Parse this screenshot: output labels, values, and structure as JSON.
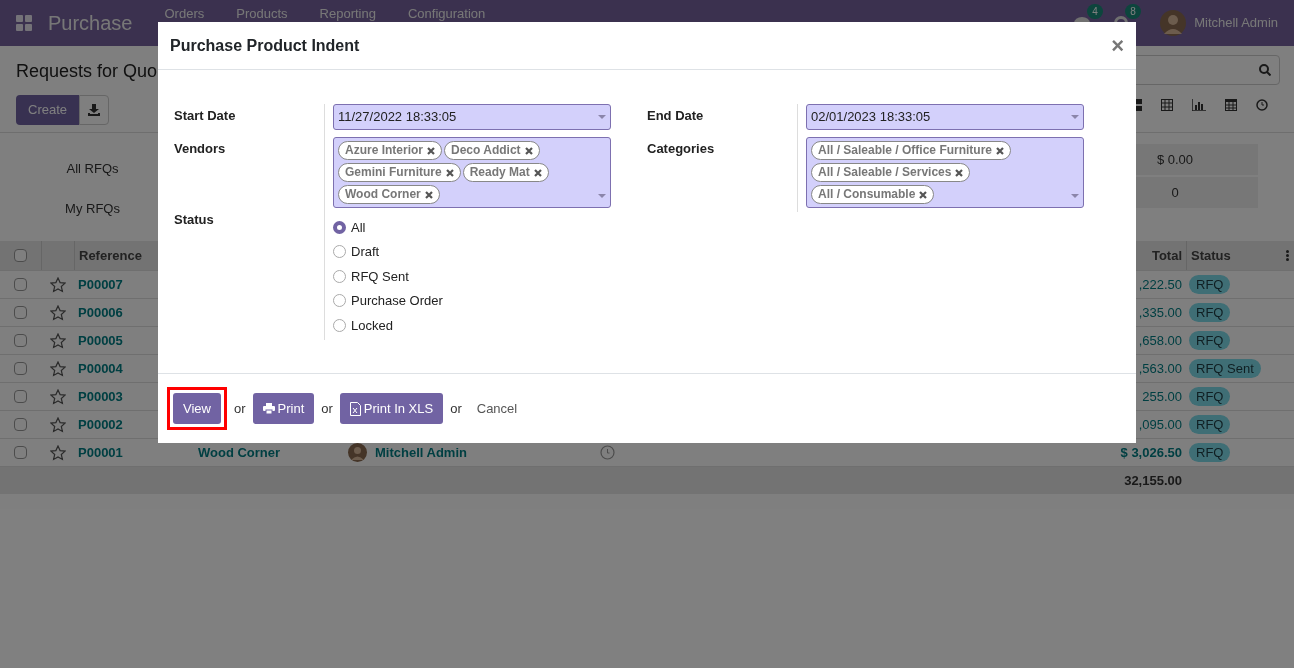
{
  "navbar": {
    "app_name": "Purchase",
    "menu": [
      "Orders",
      "Products",
      "Reporting",
      "Configuration"
    ],
    "messages_badge": "4",
    "activities_badge": "8",
    "user": "Mitchell Admin"
  },
  "control_panel": {
    "title": "Requests for Quo",
    "create_button": "Create"
  },
  "dashboard": [
    {
      "label": "All RFQs",
      "value": "$ 0.00"
    },
    {
      "label": "My RFQs",
      "value": "0"
    }
  ],
  "table": {
    "columns": [
      "Reference",
      "Total",
      "Status"
    ],
    "all_checked": false,
    "rows": [
      {
        "reference": "P00007",
        "total": ",222.50",
        "status": "RFQ",
        "emphasized": false,
        "checked": false
      },
      {
        "reference": "P00006",
        "total": ",335.00",
        "status": "RFQ",
        "emphasized": false,
        "checked": false
      },
      {
        "reference": "P00005",
        "total": ",658.00",
        "status": "RFQ",
        "emphasized": false,
        "checked": false
      },
      {
        "reference": "P00004",
        "total": ",563.00",
        "status": "RFQ Sent",
        "emphasized": false,
        "checked": false
      },
      {
        "reference": "P00003",
        "total": "255.00",
        "status": "RFQ",
        "emphasized": false,
        "checked": false
      },
      {
        "reference": "P00002",
        "total": ",095.00",
        "status": "RFQ",
        "emphasized": false,
        "checked": false
      },
      {
        "reference": "P00001",
        "vendor": "Wood Corner",
        "buyer": "Mitchell Admin",
        "total": "$ 3,026.50",
        "status": "RFQ",
        "emphasized": true,
        "checked": false
      }
    ],
    "footer_total": "32,155.00"
  },
  "dialog": {
    "title": "Purchase Product Indent",
    "close": "×",
    "start_date": {
      "label": "Start Date",
      "value": "11/27/2022 18:33:05"
    },
    "end_date": {
      "label": "End Date",
      "value": "02/01/2023 18:33:05"
    },
    "vendors": {
      "label": "Vendors",
      "tags": [
        "Azure Interior",
        "Deco Addict",
        "Gemini Furniture",
        "Ready Mat",
        "Wood Corner"
      ]
    },
    "categories": {
      "label": "Categories",
      "tags": [
        "All / Saleable / Office Furniture",
        "All / Saleable / Services",
        "All / Consumable"
      ]
    },
    "status": {
      "label": "Status",
      "options": [
        {
          "label": "All",
          "selected": true
        },
        {
          "label": "Draft",
          "selected": false
        },
        {
          "label": "RFQ Sent",
          "selected": false
        },
        {
          "label": "Purchase Order",
          "selected": false
        },
        {
          "label": "Locked",
          "selected": false
        }
      ]
    },
    "footer": [
      {
        "kind": "view",
        "label": "View",
        "highlighted": true
      },
      {
        "kind": "text",
        "label": "or"
      },
      {
        "kind": "print",
        "label": "Print"
      },
      {
        "kind": "text",
        "label": "or"
      },
      {
        "kind": "xls",
        "label": "Print In XLS"
      },
      {
        "kind": "text",
        "label": "or"
      },
      {
        "kind": "link",
        "label": "Cancel"
      }
    ]
  }
}
